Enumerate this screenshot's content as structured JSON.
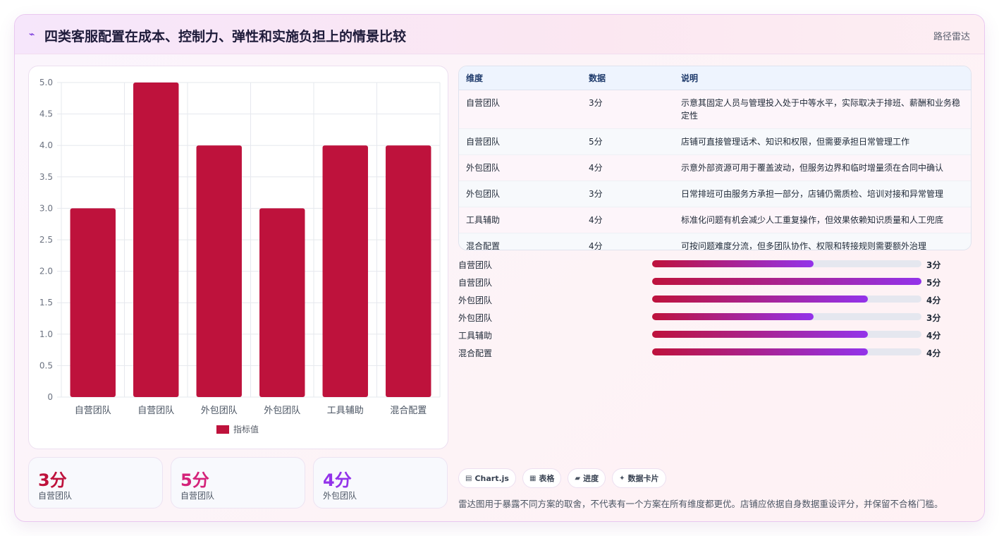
{
  "header": {
    "title": "四类客服配置在成本、控制力、弹性和实施负担上的情景比较",
    "route_label": "路径雷达",
    "logo_icon": "pulse-icon"
  },
  "chart_data": {
    "type": "bar",
    "categories": [
      "自营团队",
      "自营团队",
      "外包团队",
      "外包团队",
      "工具辅助",
      "混合配置"
    ],
    "series": [
      {
        "name": "指标值",
        "values": [
          3,
          5,
          4,
          3,
          4,
          4
        ]
      }
    ],
    "ylim": [
      0,
      5
    ],
    "yticks": [
      "0",
      "0.5",
      "1.0",
      "1.5",
      "2.0",
      "2.5",
      "3.0",
      "3.5",
      "4.0",
      "4.5",
      "5.0"
    ],
    "grid": true,
    "legend": "bottom",
    "color": "#be123c"
  },
  "stats": [
    {
      "value": "3分",
      "label": "自营团队",
      "color": "#be123c"
    },
    {
      "value": "5分",
      "label": "自营团队",
      "color": "#d4237a"
    },
    {
      "value": "4分",
      "label": "外包团队",
      "color": "#9333ea"
    }
  ],
  "table": {
    "headers": [
      "维度",
      "数据",
      "说明"
    ],
    "rows": [
      [
        "自营团队",
        "3分",
        "示意其固定人员与管理投入处于中等水平，实际取决于排班、薪酬和业务稳定性"
      ],
      [
        "自营团队",
        "5分",
        "店铺可直接管理话术、知识和权限，但需要承担日常管理工作"
      ],
      [
        "外包团队",
        "4分",
        "示意外部资源可用于覆盖波动，但服务边界和临时增量须在合同中确认"
      ],
      [
        "外包团队",
        "3分",
        "日常排班可由服务方承担一部分，店铺仍需质检、培训对接和异常管理"
      ],
      [
        "工具辅助",
        "4分",
        "标准化问题有机会减少人工重复操作，但效果依赖知识质量和人工兜底"
      ],
      [
        "混合配置",
        "4分",
        "可按问题难度分流，但多团队协作、权限和转接规则需要额外治理"
      ]
    ]
  },
  "progress": {
    "max": 5,
    "items": [
      {
        "label": "自营团队",
        "value": 3,
        "display": "3分"
      },
      {
        "label": "自营团队",
        "value": 5,
        "display": "5分"
      },
      {
        "label": "外包团队",
        "value": 4,
        "display": "4分"
      },
      {
        "label": "外包团队",
        "value": 3,
        "display": "3分"
      },
      {
        "label": "工具辅助",
        "value": 4,
        "display": "4分"
      },
      {
        "label": "混合配置",
        "value": 4,
        "display": "4分"
      }
    ]
  },
  "chips": [
    {
      "icon": "chart-icon",
      "glyph": "▤",
      "label": "Chart.js"
    },
    {
      "icon": "table-icon",
      "glyph": "▦",
      "label": "表格"
    },
    {
      "icon": "progress-icon",
      "glyph": "▰",
      "label": "进度"
    },
    {
      "icon": "sparkle-icon",
      "glyph": "✦",
      "label": "数据卡片"
    }
  ],
  "footnote": "雷达图用于暴露不同方案的取舍，不代表有一个方案在所有维度都更优。店铺应依据自身数据重设评分，并保留不合格门槛。"
}
